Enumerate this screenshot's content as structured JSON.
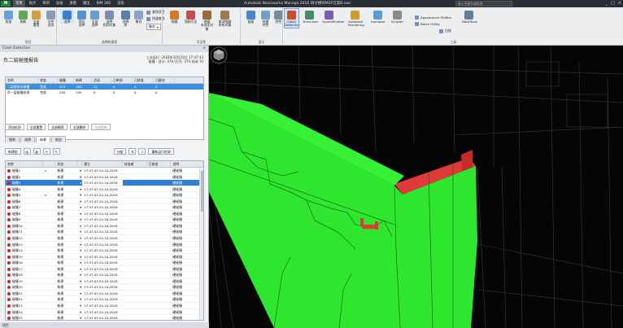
{
  "app": {
    "logo": "N",
    "title": "Autodesk Navisworks Manage 2016    研讨楼导MEP方案B.nwc",
    "search_placeholder": "键入关键字或短语",
    "window_controls": [
      "_",
      "□",
      "×"
    ]
  },
  "menu_tabs": [
    "常用",
    "视点",
    "审阅",
    "动画",
    "查看",
    "输出",
    "BIM 360",
    "渲染"
  ],
  "ribbon": {
    "big_buttons": [
      {
        "name": "附加",
        "icon": "append-icon",
        "color": "#6aa0d8"
      },
      {
        "name": "刷新",
        "icon": "refresh-icon",
        "color": "#62a85a"
      },
      {
        "name": "全部\n重置",
        "icon": "reset-icon",
        "color": "#d0a040"
      },
      {
        "name": "文件\n选项",
        "icon": "file-options-icon",
        "color": "#8a9bb8"
      },
      {
        "name": "选择",
        "icon": "select-icon",
        "color": "#3b7fd0"
      },
      {
        "name": "保存\n选择",
        "icon": "save-selection-icon",
        "color": "#5b8fd4"
      },
      {
        "name": "全部\n选择",
        "icon": "select-all-icon",
        "color": "#6b9ad0"
      },
      {
        "name": "选择\n相同对象",
        "icon": "select-same-icon",
        "color": "#7a8fb3"
      },
      {
        "name": "选择\n树",
        "icon": "selection-tree-icon",
        "color": "#5c7fa8"
      },
      {
        "name": "集合",
        "icon": "sets-icon",
        "color": "#8aa3c8"
      },
      {
        "name": "隐藏",
        "icon": "hide-icon",
        "color": "#d87a2a"
      },
      {
        "name": "强制可见",
        "icon": "require-icon",
        "color": "#c05050"
      },
      {
        "name": "隐藏\n未选定对象",
        "icon": "hide-unselected-icon",
        "color": "#9a6a3a"
      },
      {
        "name": "取消隐藏\n所有对象",
        "icon": "unhide-all-icon",
        "color": "#a07a50"
      },
      {
        "name": "链接",
        "icon": "links-icon",
        "color": "#4b86c9"
      },
      {
        "name": "快捷\n特性",
        "icon": "quick-props-icon",
        "color": "#6fa0c8"
      },
      {
        "name": "特性",
        "icon": "properties-icon",
        "color": "#7a8aa0"
      },
      {
        "name": "Clash\nDetective",
        "icon": "clash-detective-icon",
        "color": "#c8502a"
      },
      {
        "name": "TimeLiner",
        "icon": "timeliner-icon",
        "color": "#3e8e6a"
      },
      {
        "name": "Quantification",
        "icon": "quantification-icon",
        "color": "#7a5fb0"
      },
      {
        "name": "Autodesk\nRendering",
        "icon": "rendering-icon",
        "color": "#d29b2a"
      },
      {
        "name": "Animator",
        "icon": "animator-icon",
        "color": "#5a9ad8"
      },
      {
        "name": "Scripter",
        "icon": "scripter-icon",
        "color": "#8a8a8a"
      },
      {
        "name": "DataTools",
        "icon": "datatools-icon",
        "color": "#5f7f9f"
      }
    ],
    "small_items": [
      "查找项目",
      "快速查找",
      "Appearance Profiler",
      "Batch Utility",
      "比较"
    ],
    "select_value": "集合",
    "groups": [
      "项目",
      "选择和搜索",
      "可见性",
      "显示",
      "工具"
    ]
  },
  "panel": {
    "header": "Clash Detective",
    "close": "×",
    "report_title": "负二层碰撞报告",
    "last_run_label": "上次运行: 2018年10月24日 17:47:43",
    "conflict_summary": "碰撞 - 总计: 374 (打开: 374  关闭: 0)",
    "test_columns": [
      "名称",
      "状态",
      "碰撞",
      "新建",
      "活动",
      "已审阅",
      "已核准",
      "已解决"
    ],
    "tests": [
      {
        "name": "二层给排水碰撞",
        "status": "完成",
        "clashes": "374",
        "new": "363",
        "active": "11",
        "reviewed": "0",
        "approved": "0",
        "resolved": "0"
      },
      {
        "name": "负一层碰撞检测",
        "status": "完成",
        "clashes": "290",
        "new": "290",
        "active": "0",
        "reviewed": "0",
        "approved": "0",
        "resolved": "0"
      }
    ],
    "test_buttons": [
      "添加检测",
      "全部重置",
      "全部精简",
      "全部删除",
      "全部更新"
    ],
    "tabs": [
      "规则",
      "选择",
      "结果",
      "报告"
    ],
    "result_toolbar": {
      "new_group": "新建组",
      "assign": "分配",
      "rerun": "重新运行检测"
    },
    "result_columns": [
      "名称",
      "",
      "状态",
      "",
      "建立",
      "核准者",
      "已核准",
      "说明"
    ],
    "results": [
      {
        "name": "碰撞1",
        "status": "新建",
        "found": "17:47:43 24-10-2018",
        "desc": "硬碰撞"
      },
      {
        "name": "碰撞2",
        "status": "新建",
        "found": "17:47:43 24-10-2018",
        "desc": "硬碰撞"
      },
      {
        "name": "碰撞3",
        "status": "新建",
        "found": "17:47:43 24-10-2018",
        "desc": "硬碰撞"
      },
      {
        "name": "碰撞4",
        "status": "新建",
        "found": "17:47:43 24-10-2018",
        "desc": "硬碰撞"
      },
      {
        "name": "碰撞5",
        "status": "新建",
        "found": "17:47:43 24-10-2018",
        "desc": "硬碰撞"
      },
      {
        "name": "碰撞6",
        "status": "新建",
        "found": "17:47:43 24-10-2018",
        "desc": "硬碰撞"
      },
      {
        "name": "碰撞7",
        "status": "新建",
        "found": "17:47:43 24-10-2018",
        "desc": "硬碰撞"
      },
      {
        "name": "碰撞8",
        "status": "新建",
        "found": "17:47:43 24-10-2018",
        "desc": "硬碰撞"
      },
      {
        "name": "碰撞9",
        "status": "新建",
        "found": "17:47:43 24-10-2018",
        "desc": "硬碰撞"
      },
      {
        "name": "碰撞10",
        "status": "新建",
        "found": "17:47:43 24-10-2018",
        "desc": "硬碰撞"
      },
      {
        "name": "碰撞11",
        "status": "新建",
        "found": "17:47:43 24-10-2018",
        "desc": "硬碰撞"
      },
      {
        "name": "碰撞12",
        "status": "新建",
        "found": "17:47:43 24-10-2018",
        "desc": "硬碰撞"
      },
      {
        "name": "碰撞13",
        "status": "新建",
        "found": "17:47:43 24-10-2018",
        "desc": "硬碰撞"
      },
      {
        "name": "碰撞14",
        "status": "新建",
        "found": "17:47:43 24-10-2018",
        "desc": "硬碰撞"
      },
      {
        "name": "碰撞15",
        "status": "新建",
        "found": "17:47:43 24-10-2018",
        "desc": "硬碰撞"
      },
      {
        "name": "碰撞16",
        "status": "新建",
        "found": "17:47:43 24-10-2018",
        "desc": "硬碰撞"
      },
      {
        "name": "碰撞17",
        "status": "新建",
        "found": "17:47:43 24-10-2018",
        "desc": "硬碰撞"
      },
      {
        "name": "碰撞18",
        "status": "新建",
        "found": "17:47:43 24-10-2018",
        "desc": "硬碰撞"
      },
      {
        "name": "碰撞19",
        "status": "新建",
        "found": "17:47:43 24-10-2018",
        "desc": "硬碰撞"
      },
      {
        "name": "碰撞20",
        "status": "新建",
        "found": "17:47:43 24-10-2018",
        "desc": "硬碰撞"
      },
      {
        "name": "碰撞21",
        "status": "新建",
        "found": "17:47:43 24-10-2018",
        "desc": "硬碰撞"
      },
      {
        "name": "碰撞22",
        "status": "新建",
        "found": "17:47:43 24-10-2018",
        "desc": "硬碰撞"
      },
      {
        "name": "碰撞23",
        "status": "新建",
        "found": "17:47:43 24-10-2018",
        "desc": "硬碰撞"
      },
      {
        "name": "碰撞24",
        "status": "新建",
        "found": "17:47:43 24-10-2018",
        "desc": "硬碰撞"
      },
      {
        "name": "碰撞25",
        "status": "新建",
        "found": "17:47:43 24-10-2018",
        "desc": "硬碰撞"
      }
    ],
    "selected_result": 2,
    "status_bar": "项目"
  },
  "viewport": {
    "green": "#2ee62e",
    "red": "#e0393a",
    "background": "#050505"
  }
}
